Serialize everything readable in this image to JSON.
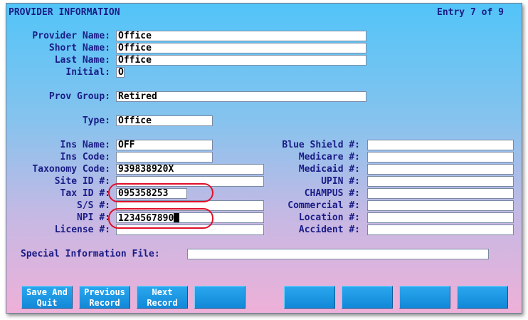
{
  "header": {
    "title": "PROVIDER INFORMATION",
    "entry": "Entry 7 of 9"
  },
  "labels": {
    "provider_name": "Provider Name:",
    "short_name": "Short Name:",
    "last_name": "Last Name:",
    "initial": "Initial:",
    "prov_group": "Prov Group:",
    "type": "Type:",
    "ins_name": "Ins Name:",
    "ins_code": "Ins Code:",
    "taxonomy_code": "Taxonomy Code:",
    "site_id": "Site ID #:",
    "tax_id": "Tax ID #:",
    "ss": "S/S #:",
    "npi": "NPI #:",
    "license": "License #:",
    "blue_shield": "Blue Shield #:",
    "medicare": "Medicare #:",
    "medicaid": "Medicaid #:",
    "upin": "UPIN #:",
    "champus": "CHAMPUS #:",
    "commercial": "Commercial #:",
    "location": "Location #:",
    "accident": "Accident #:",
    "special_info": "Special Information File:"
  },
  "values": {
    "provider_name": "Office",
    "short_name": "Office",
    "last_name": "Office",
    "initial": "O",
    "prov_group": "Retired",
    "type": "Office",
    "ins_name": "OFF",
    "ins_code": "",
    "taxonomy_code": "939838920X",
    "site_id": "",
    "tax_id": "095358253",
    "ss": "",
    "npi": "1234567890",
    "license": "",
    "blue_shield": "",
    "medicare": "",
    "medicaid": "",
    "upin": "",
    "champus": "",
    "commercial": "",
    "location": "",
    "accident": "",
    "special_info": ""
  },
  "function_keys": {
    "f1": "Save And\nQuit",
    "f2": "Previous\nRecord",
    "f3": "Next\nRecord",
    "f4": "",
    "f5": "",
    "f6": "",
    "f7": "",
    "f8": ""
  },
  "colors": {
    "label_text": "#1a1c86",
    "button": "#1a8fdc",
    "highlight": "#e0102a"
  }
}
